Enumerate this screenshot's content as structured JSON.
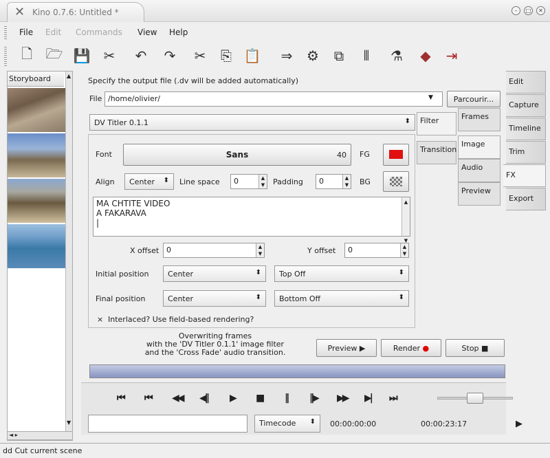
{
  "window": {
    "title": "Kino 0.7.6: Untitled *"
  },
  "menu": [
    {
      "label": "File",
      "enabled": true
    },
    {
      "label": "Edit",
      "enabled": false
    },
    {
      "label": "Commands",
      "enabled": false
    },
    {
      "label": "View",
      "enabled": true
    },
    {
      "label": "Help",
      "enabled": true
    }
  ],
  "toolbar_icons": [
    "new-icon",
    "open-icon",
    "save-icon",
    "scissors-icon",
    "undo-icon",
    "redo-icon",
    "cut-icon",
    "copy-icon",
    "paste-icon",
    "capture-icon",
    "split-icon",
    "join-icon",
    "clip-icon",
    "publish-icon",
    "eraser-icon",
    "exit-icon"
  ],
  "storyboard": {
    "label": "Storyboard",
    "scroll_arrow": "▲",
    "down_arrow": "▼",
    "hscroll": "◄ ▸"
  },
  "output": {
    "description": "Specify the output file (.dv will be added automatically)",
    "file_label": "File",
    "file_value": "/home/olivier/",
    "browse_label": "Parcourir..."
  },
  "filter": {
    "selected": "DV Titler 0.1.1",
    "font_label": "Font",
    "font_name": "Sans",
    "font_size": "40",
    "fg_label": "FG",
    "fg_color": "#e01010",
    "align_label": "Align",
    "align_value": "Center",
    "line_space_label": "Line space",
    "line_space_value": "0",
    "padding_label": "Padding",
    "padding_value": "0",
    "bg_label": "BG",
    "text_lines": [
      "MA CHTITE VIDEO",
      "A FAKARAVA"
    ],
    "x_offset_label": "X offset",
    "x_offset_value": "0",
    "y_offset_label": "Y offset",
    "y_offset_value": "0",
    "initial_position_label": "Initial position",
    "initial_position_h": "Center",
    "initial_position_v": "Top Off",
    "final_position_label": "Final position",
    "final_position_h": "Center",
    "final_position_v": "Bottom Off",
    "interlaced_mark": "×",
    "interlaced_label": "Interlaced? Use field-based rendering?"
  },
  "inner_tabs": {
    "left": [
      "Filter",
      "Transition"
    ],
    "right": [
      "Frames",
      "Image",
      "Audio",
      "Preview"
    ]
  },
  "render": {
    "status_lines": [
      "Overwriting frames",
      "with the 'DV Titler 0.1.1' image filter",
      "and the 'Cross Fade' audio transition."
    ],
    "preview_label": "Preview",
    "render_label": "Render",
    "stop_label": "Stop",
    "render_dot_color": "#e00000"
  },
  "side_tabs": [
    "Edit",
    "Capture",
    "Timeline",
    "Trim",
    "FX",
    "Export"
  ],
  "side_tab_selected": "FX",
  "player": {
    "buttons": [
      "⏮",
      "⏮",
      "◀◀",
      "◀‖",
      "▶",
      "■",
      "‖",
      "‖▶",
      "▶▶",
      "▶|",
      "⏭"
    ],
    "time_mode": "Timecode",
    "position": "00:00:00:00",
    "duration": "00:00:23:17",
    "next_arrow": "▶"
  },
  "status": {
    "text": "dd   Cut current scene"
  }
}
